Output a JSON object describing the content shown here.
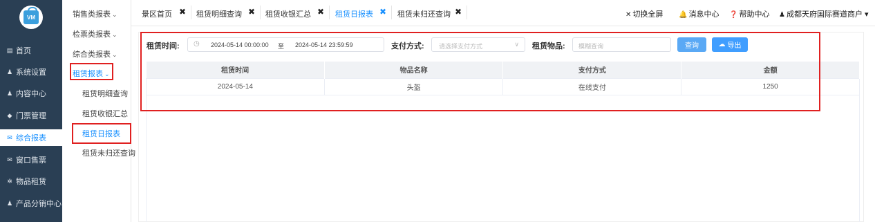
{
  "sidebar": {
    "logo_text": "VM",
    "items": [
      {
        "icon": "home-icon",
        "glyph": "▤",
        "label": "首页"
      },
      {
        "icon": "user-icon",
        "glyph": "♟",
        "label": "系统设置"
      },
      {
        "icon": "user-icon",
        "glyph": "♟",
        "label": "内容中心"
      },
      {
        "icon": "tag-icon",
        "glyph": "◆",
        "label": "门票管理"
      },
      {
        "icon": "mail-icon",
        "glyph": "✉",
        "label": "综合报表"
      },
      {
        "icon": "mail-icon",
        "glyph": "✉",
        "label": "窗口售票"
      },
      {
        "icon": "gear-icon",
        "glyph": "✲",
        "label": "物品租赁"
      },
      {
        "icon": "user-icon",
        "glyph": "♟",
        "label": "产品分销中心"
      }
    ]
  },
  "subnav": {
    "groups": [
      "销售类报表",
      "检票类报表",
      "综合类报表",
      "租赁报表"
    ],
    "children": [
      "租赁明细查询",
      "租赁收银汇总",
      "租赁日报表",
      "租赁未归还查询"
    ],
    "caret": "⌄"
  },
  "tabs": {
    "items": [
      "景区首页",
      "租赁明细查询",
      "租赁收银汇总",
      "租赁日报表",
      "租赁未归还查询"
    ],
    "close": "✖"
  },
  "topright": {
    "fullscreen": "切换全屏",
    "messages": "消息中心",
    "help": "帮助中心",
    "merchant": "成都天府国际赛道商户",
    "merchant_caret": "▾"
  },
  "filters": {
    "time_label": "租赁时间:",
    "date_start": "2024-05-14 00:00:00",
    "date_sep": "至",
    "date_end": "2024-05-14 23:59:59",
    "pay_label": "支付方式:",
    "pay_placeholder": "请选择支付方式",
    "item_label": "租赁物品:",
    "item_placeholder": "模糊查询",
    "query_btn": "查询",
    "export_btn": "导出",
    "clock_glyph": "◷",
    "select_arrow": "∨",
    "cloud_glyph": "☁"
  },
  "table": {
    "columns": [
      "租赁时间",
      "物品名称",
      "支付方式",
      "金额"
    ],
    "rows": [
      [
        "2024-05-14",
        "头盔",
        "在线支付",
        "1250"
      ]
    ]
  },
  "colors": {
    "sidebar_bg": "#2a3f54",
    "accent": "#1890ff",
    "highlight_box": "#e02020"
  }
}
